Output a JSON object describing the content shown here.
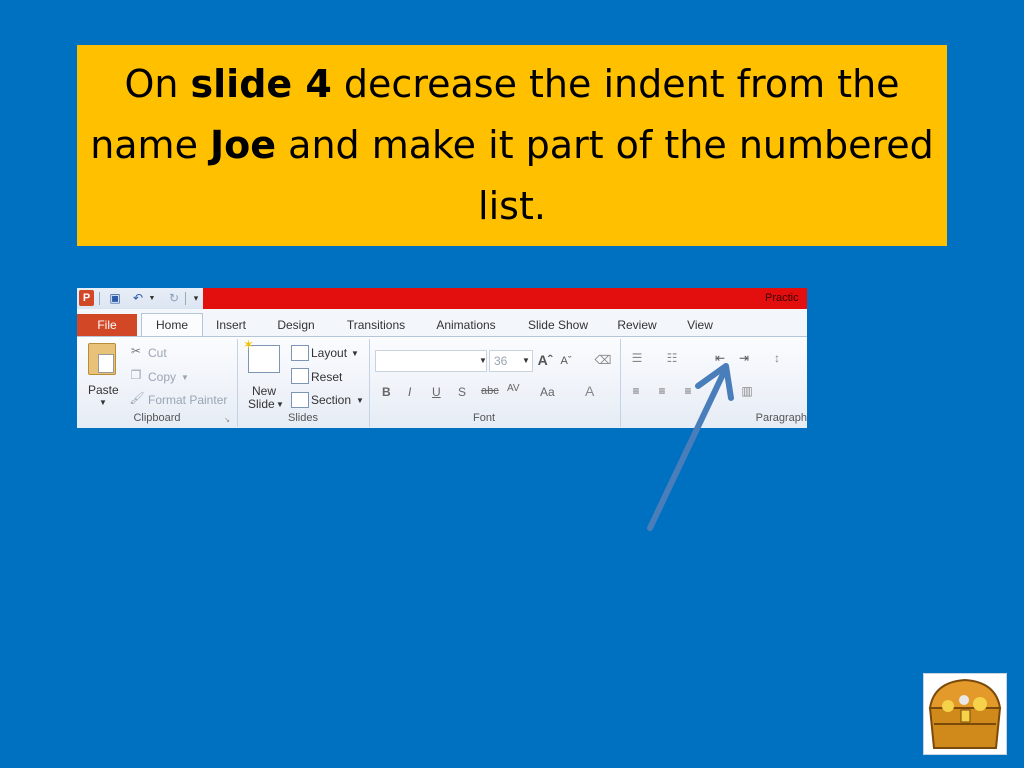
{
  "instruction": {
    "part1": "On ",
    "bold1": "slide 4",
    "part2": " decrease the indent from the name ",
    "bold2": "Joe",
    "part3": " and make it part of the numbered list."
  },
  "ribbon": {
    "app_title": "Practic",
    "logo_letter": "P",
    "tabs": [
      "File",
      "Home",
      "Insert",
      "Design",
      "Transitions",
      "Animations",
      "Slide Show",
      "Review",
      "View"
    ],
    "clipboard": {
      "paste": "Paste",
      "cut": "Cut",
      "copy": "Copy",
      "format_painter": "Format Painter",
      "group": "Clipboard"
    },
    "slides": {
      "new_slide_line1": "New",
      "new_slide_line2": "Slide",
      "layout": "Layout",
      "reset": "Reset",
      "section": "Section",
      "group": "Slides"
    },
    "font": {
      "size": "36",
      "group": "Font",
      "bold": "B",
      "italic": "I",
      "underline": "U",
      "shadow": "S",
      "strike": "abc",
      "spacing": "AV",
      "case": "Aa",
      "color": "A"
    },
    "paragraph": {
      "group": "Paragraph"
    }
  },
  "colors": {
    "background": "#0070c0",
    "instruction_box": "#ffc000",
    "arrow": "#4a7ebb"
  },
  "icons": [
    "treasure-chest-icon",
    "decrease-indent-icon",
    "increase-indent-icon"
  ]
}
